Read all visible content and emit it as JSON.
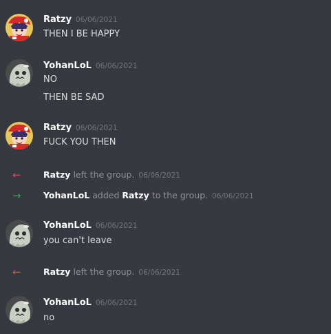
{
  "colors": {
    "background": "#36393f",
    "author": "#ffffff",
    "message": "#dcddde",
    "timestamp": "#72767d",
    "system_text": "#8e9297",
    "leave_arrow": "#ed4245",
    "join_arrow": "#3ba55c"
  },
  "icons": {
    "leave": "←",
    "join": "→"
  },
  "messages": [
    {
      "author": "Ratzy",
      "time": "06/06/2021",
      "lines": [
        "THEN I BE HAPPY"
      ]
    },
    {
      "author": "YohanLoL",
      "time": "06/06/2021",
      "lines": [
        "NO",
        "THEN BE SAD"
      ]
    },
    {
      "author": "Ratzy",
      "time": "06/06/2021",
      "lines": [
        "FUCK YOU THEN"
      ]
    },
    {
      "author": "YohanLoL",
      "time": "06/06/2021",
      "lines": [
        "you can't leave"
      ]
    },
    {
      "author": "YohanLoL",
      "time": "06/06/2021",
      "lines": [
        "no"
      ]
    }
  ],
  "system": [
    {
      "user": "Ratzy",
      "text": "left the group.",
      "time": "06/06/2021"
    },
    {
      "user": "YohanLoL",
      "text": "added",
      "target": "Ratzy",
      "text2": "to the group.",
      "time": "06/06/2021"
    },
    {
      "user": "Ratzy",
      "text": "left the group.",
      "time": "06/06/2021"
    }
  ]
}
